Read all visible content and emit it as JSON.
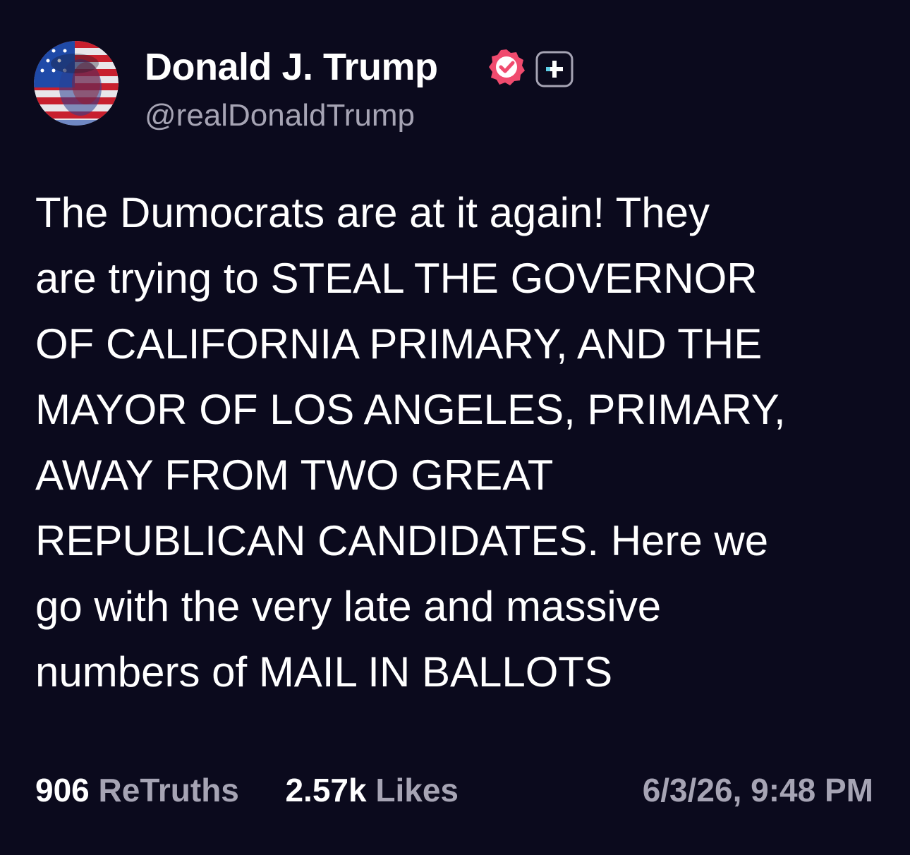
{
  "post": {
    "author": {
      "display_name": "Donald J. Trump",
      "handle": "@realDonaldTrump",
      "avatar_icon": "flag-portrait-avatar",
      "verified_icon": "verified-badge-icon",
      "plus_icon": "plus-badge-icon"
    },
    "text": "The Dumocrats are at it again! They\nare trying to STEAL THE GOVERNOR\nOF CALIFORNIA PRIMARY, AND THE\nMAYOR OF LOS ANGELES, PRIMARY,\nAWAY FROM TWO GREAT\nREPUBLICAN CANDIDATES. Here we\ngo with the very late and massive\nnumbers of MAIL IN BALLOTS",
    "stats": {
      "retruths_count": "906",
      "retruths_label": "ReTruths",
      "likes_count": "2.57k",
      "likes_label": "Likes"
    },
    "timestamp": "6/3/26, 9:48 PM"
  },
  "colors": {
    "background": "#0b0a1d",
    "text_primary": "#ffffff",
    "text_secondary": "#a6a4b4",
    "verified_badge": "#f04b6e",
    "plus_badge": "#5fd0e8"
  }
}
